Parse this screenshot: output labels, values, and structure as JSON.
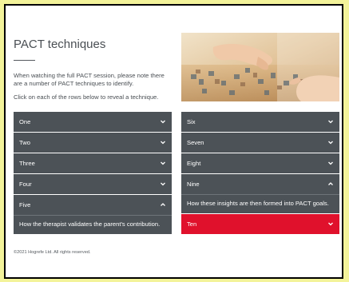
{
  "page": {
    "title": "PACT techniques",
    "intro": "When watching the full PACT session, please note there are a number of PACT techniques to identify.",
    "instruction": "Click on each of the rows below to reveal a technique.",
    "footer": "©2021 Hogrefe Ltd. All rights reserved."
  },
  "image": {
    "alt_icon": "puzzle-photo"
  },
  "left_column": {
    "rows": [
      {
        "label": "One",
        "state": "collapsed"
      },
      {
        "label": "Two",
        "state": "collapsed"
      },
      {
        "label": "Three",
        "state": "collapsed"
      },
      {
        "label": "Four",
        "state": "collapsed"
      },
      {
        "label": "Five",
        "state": "expanded",
        "content": "How the therapist validates the parent's contribution."
      }
    ]
  },
  "right_column": {
    "rows": [
      {
        "label": "Six",
        "state": "collapsed"
      },
      {
        "label": "Seven",
        "state": "collapsed"
      },
      {
        "label": "Eight",
        "state": "collapsed"
      },
      {
        "label": "Nine",
        "state": "expanded",
        "content": "How these insights are then formed into PACT goals."
      },
      {
        "label": "Ten",
        "state": "collapsed",
        "highlighted": true
      }
    ]
  },
  "colors": {
    "row_bg": "#4c5257",
    "highlight": "#e0112c",
    "page_bg": "#f3f39a"
  }
}
